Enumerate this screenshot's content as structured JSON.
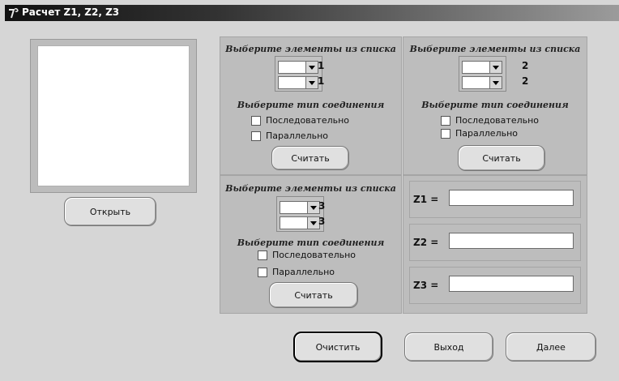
{
  "window": {
    "title": "Расчет Z1, Z2, Z3"
  },
  "image_panel": {
    "open_label": "Открыть"
  },
  "group1": {
    "title": "Выберите элементы из списка",
    "combo1_index": "1",
    "combo2_index": "1",
    "conn_title": "Выберите тип соединения",
    "serial_label": "Последовательно",
    "parallel_label": "Параллельно",
    "calc_label": "Считать"
  },
  "group2": {
    "title": "Выберите элементы из списка",
    "combo1_index": "2",
    "combo2_index": "2",
    "conn_title": "Выберите тип соединения",
    "serial_label": "Последовательно",
    "parallel_label": "Параллельно",
    "calc_label": "Считать"
  },
  "group3": {
    "title": "Выберите элементы из списка",
    "combo1_index": "3",
    "combo2_index": "3",
    "conn_title": "Выберите тип соединения",
    "serial_label": "Последовательно",
    "parallel_label": "Параллельно",
    "calc_label": "Считать"
  },
  "results": {
    "z1_label": "Z1 =",
    "z2_label": "Z2 =",
    "z3_label": "Z3 =",
    "z1_value": "",
    "z2_value": "",
    "z3_value": ""
  },
  "footer": {
    "clear_label": "Очистить",
    "exit_label": "Выход",
    "next_label": "Далее"
  },
  "icons": {
    "title_icon": "app-icon",
    "dropdown_icon": "chevron-down-icon"
  }
}
